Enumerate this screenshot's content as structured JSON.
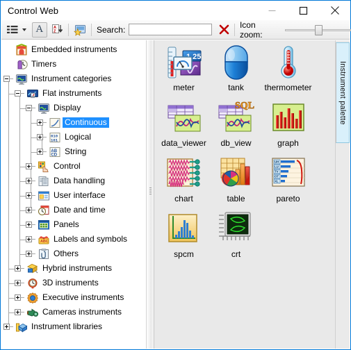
{
  "window": {
    "title": "Control Web",
    "controls": {
      "minimize": "minimize-button",
      "maximize": "maximize-button",
      "close": "close-button"
    },
    "accent_color": "#0078d7",
    "titlebar_bg": "#ffffff"
  },
  "toolbar": {
    "view_list_label": "view-list",
    "dropdown_label": "view-list-dropdown",
    "font_button_label": "A",
    "sort_button_label": "sort-a-z",
    "favorites_button_label": "favorites",
    "search_label": "Search:",
    "search_value": "",
    "search_placeholder": "",
    "clear_label": "clear-search",
    "zoom_label": "Icon zoom:",
    "zoom_value": 45
  },
  "side_tab": {
    "label": "Instrument palette",
    "bg": "#d9f0fb",
    "border": "#8ec7e0"
  },
  "tree": {
    "selection_color": "#1e90ff",
    "items": [
      {
        "label": "Embedded instruments",
        "depth": 0,
        "expander": "none",
        "icon": "embedded-instruments-icon",
        "selected": false
      },
      {
        "label": "Timers",
        "depth": 0,
        "expander": "none",
        "icon": "timers-icon",
        "selected": false
      },
      {
        "label": "Instrument categories",
        "depth": 0,
        "expander": "minus",
        "icon": "instrument-categories-icon",
        "selected": false
      },
      {
        "label": "Flat instruments",
        "depth": 1,
        "expander": "minus",
        "icon": "flat-instruments-icon",
        "selected": false
      },
      {
        "label": "Display",
        "depth": 2,
        "expander": "minus",
        "icon": "display-icon",
        "selected": false
      },
      {
        "label": "Continuous",
        "depth": 3,
        "expander": "plus",
        "icon": "continuous-icon",
        "selected": true
      },
      {
        "label": "Logical",
        "depth": 3,
        "expander": "plus",
        "icon": "logical-icon",
        "selected": false
      },
      {
        "label": "String",
        "depth": 3,
        "expander": "plus",
        "icon": "string-icon",
        "selected": false
      },
      {
        "label": "Control",
        "depth": 2,
        "expander": "plus",
        "icon": "control-icon",
        "selected": false
      },
      {
        "label": "Data handling",
        "depth": 2,
        "expander": "plus",
        "icon": "data-handling-icon",
        "selected": false
      },
      {
        "label": "User interface",
        "depth": 2,
        "expander": "plus",
        "icon": "user-interface-icon",
        "selected": false
      },
      {
        "label": "Date and time",
        "depth": 2,
        "expander": "plus",
        "icon": "date-and-time-icon",
        "selected": false
      },
      {
        "label": "Panels",
        "depth": 2,
        "expander": "plus",
        "icon": "panels-icon",
        "selected": false
      },
      {
        "label": "Labels and symbols",
        "depth": 2,
        "expander": "plus",
        "icon": "labels-and-symbols-icon",
        "selected": false
      },
      {
        "label": "Others",
        "depth": 2,
        "expander": "plus",
        "icon": "others-icon",
        "selected": false
      },
      {
        "label": "Hybrid instruments",
        "depth": 1,
        "expander": "plus",
        "icon": "hybrid-instruments-icon",
        "selected": false
      },
      {
        "label": "3D instruments",
        "depth": 1,
        "expander": "plus",
        "icon": "3d-instruments-icon",
        "selected": false
      },
      {
        "label": "Executive instruments",
        "depth": 1,
        "expander": "plus",
        "icon": "executive-instruments-icon",
        "selected": false
      },
      {
        "label": "Cameras instruments",
        "depth": 1,
        "expander": "plus",
        "icon": "cameras-instruments-icon",
        "selected": false
      },
      {
        "label": "Instrument libraries",
        "depth": 0,
        "expander": "plus",
        "icon": "instrument-libraries-icon",
        "selected": false
      }
    ]
  },
  "palette": {
    "background": "#e9e9e9",
    "icons": [
      {
        "label": "meter",
        "icon": "meter-icon",
        "col": 0,
        "row": 0
      },
      {
        "label": "tank",
        "icon": "tank-icon",
        "col": 1,
        "row": 0
      },
      {
        "label": "thermometer",
        "icon": "thermometer-icon",
        "col": 2,
        "row": 0
      },
      {
        "label": "data_viewer",
        "icon": "data-viewer-icon",
        "col": 0,
        "row": 1
      },
      {
        "label": "db_view",
        "icon": "db-view-icon",
        "col": 1,
        "row": 1
      },
      {
        "label": "graph",
        "icon": "graph-icon",
        "col": 2,
        "row": 1
      },
      {
        "label": "chart",
        "icon": "chart-icon",
        "col": 0,
        "row": 2
      },
      {
        "label": "table",
        "icon": "table-icon",
        "col": 1,
        "row": 2
      },
      {
        "label": "pareto",
        "icon": "pareto-icon",
        "col": 2,
        "row": 2
      },
      {
        "label": "spcm",
        "icon": "spcm-icon",
        "col": 0,
        "row": 3
      },
      {
        "label": "crt",
        "icon": "crt-icon",
        "col": 1,
        "row": 3
      }
    ],
    "pareto_row_labels": [
      "UH",
      "LU",
      "TV",
      "OT",
      "XL"
    ],
    "db_view_badge": "SQL",
    "meter_display_value": "1 25"
  }
}
